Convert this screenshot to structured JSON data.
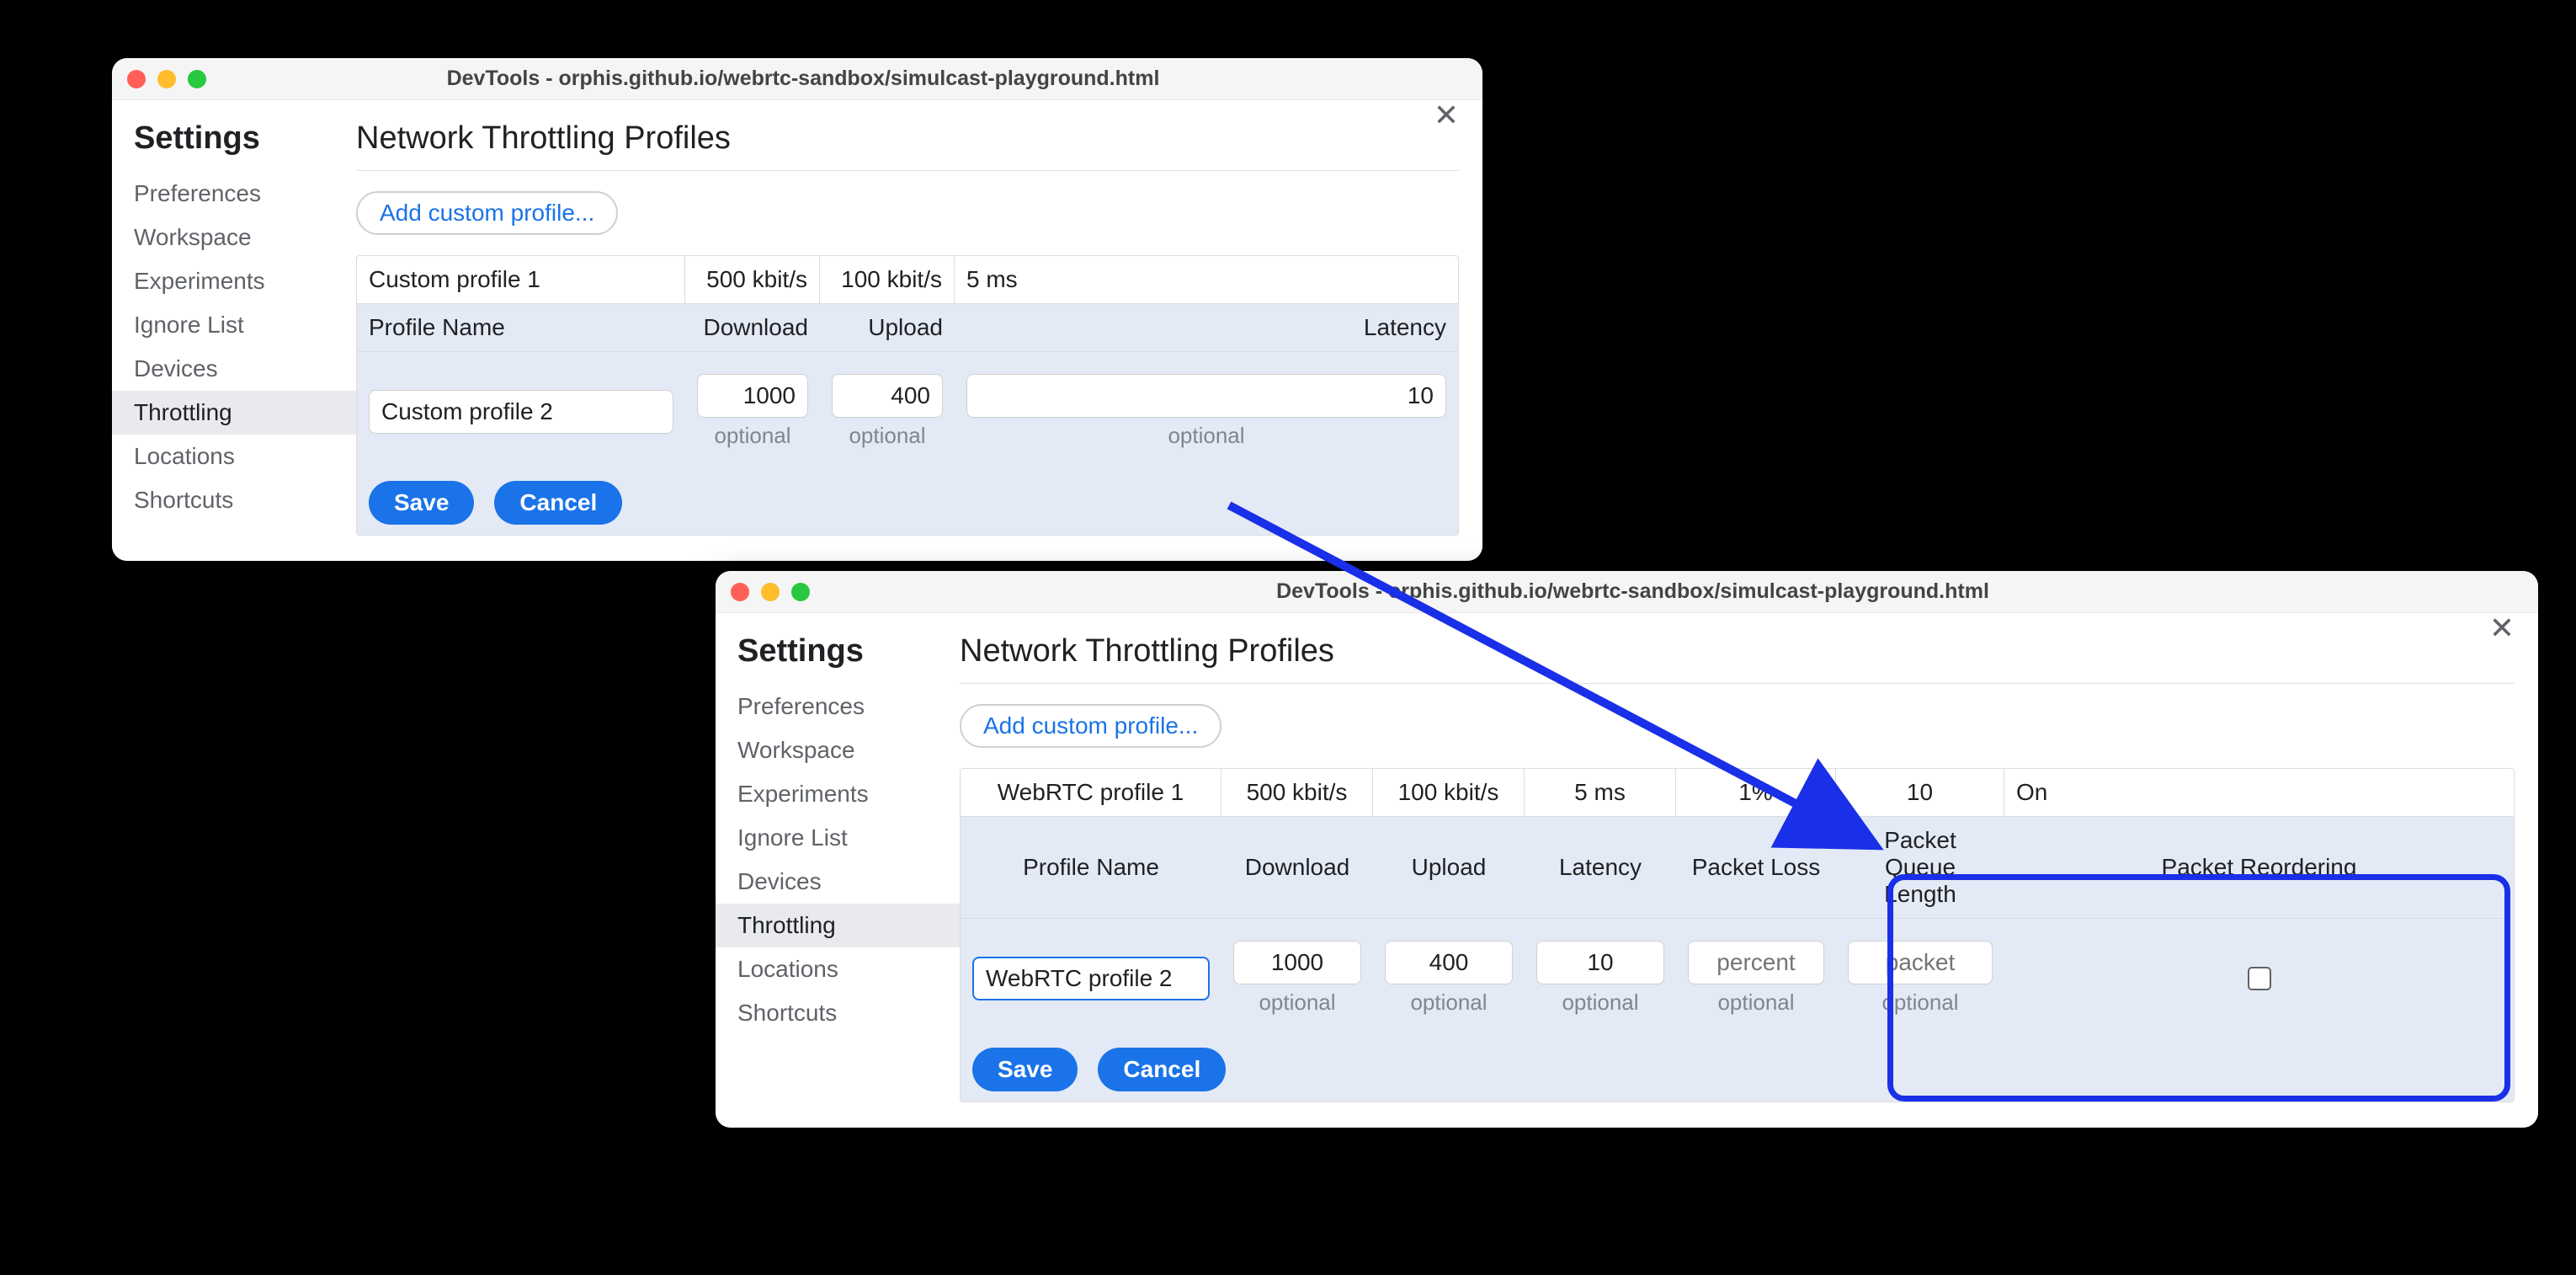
{
  "window_title": "DevTools - orphis.github.io/webrtc-sandbox/simulcast-playground.html",
  "settings_label": "Settings",
  "sidebar": {
    "items": [
      {
        "label": "Preferences"
      },
      {
        "label": "Workspace"
      },
      {
        "label": "Experiments"
      },
      {
        "label": "Ignore List"
      },
      {
        "label": "Devices"
      },
      {
        "label": "Throttling"
      },
      {
        "label": "Locations"
      },
      {
        "label": "Shortcuts"
      }
    ]
  },
  "main": {
    "title": "Network Throttling Profiles",
    "add_button": "Add custom profile...",
    "save": "Save",
    "cancel": "Cancel",
    "optional": "optional"
  },
  "win1": {
    "headers": {
      "name": "Profile Name",
      "download": "Download",
      "upload": "Upload",
      "latency": "Latency"
    },
    "existing": {
      "name": "Custom profile 1",
      "download": "500 kbit/s",
      "upload": "100 kbit/s",
      "latency": "5 ms"
    },
    "editor": {
      "name": "Custom profile 2",
      "download": "1000",
      "upload": "400",
      "latency": "10"
    }
  },
  "win2": {
    "headers": {
      "name": "Profile Name",
      "download": "Download",
      "upload": "Upload",
      "latency": "Latency",
      "packet_loss": "Packet Loss",
      "packet_queue": "Packet Queue Length",
      "packet_reorder": "Packet Reordering"
    },
    "existing": {
      "name": "WebRTC profile 1",
      "download": "500 kbit/s",
      "upload": "100 kbit/s",
      "latency": "5 ms",
      "packet_loss": "1%",
      "packet_queue": "10",
      "packet_reorder": "On"
    },
    "editor": {
      "name": "WebRTC profile 2",
      "download": "1000",
      "upload": "400",
      "latency": "10",
      "packet_loss_placeholder": "percent",
      "packet_queue_placeholder": "packet"
    }
  }
}
